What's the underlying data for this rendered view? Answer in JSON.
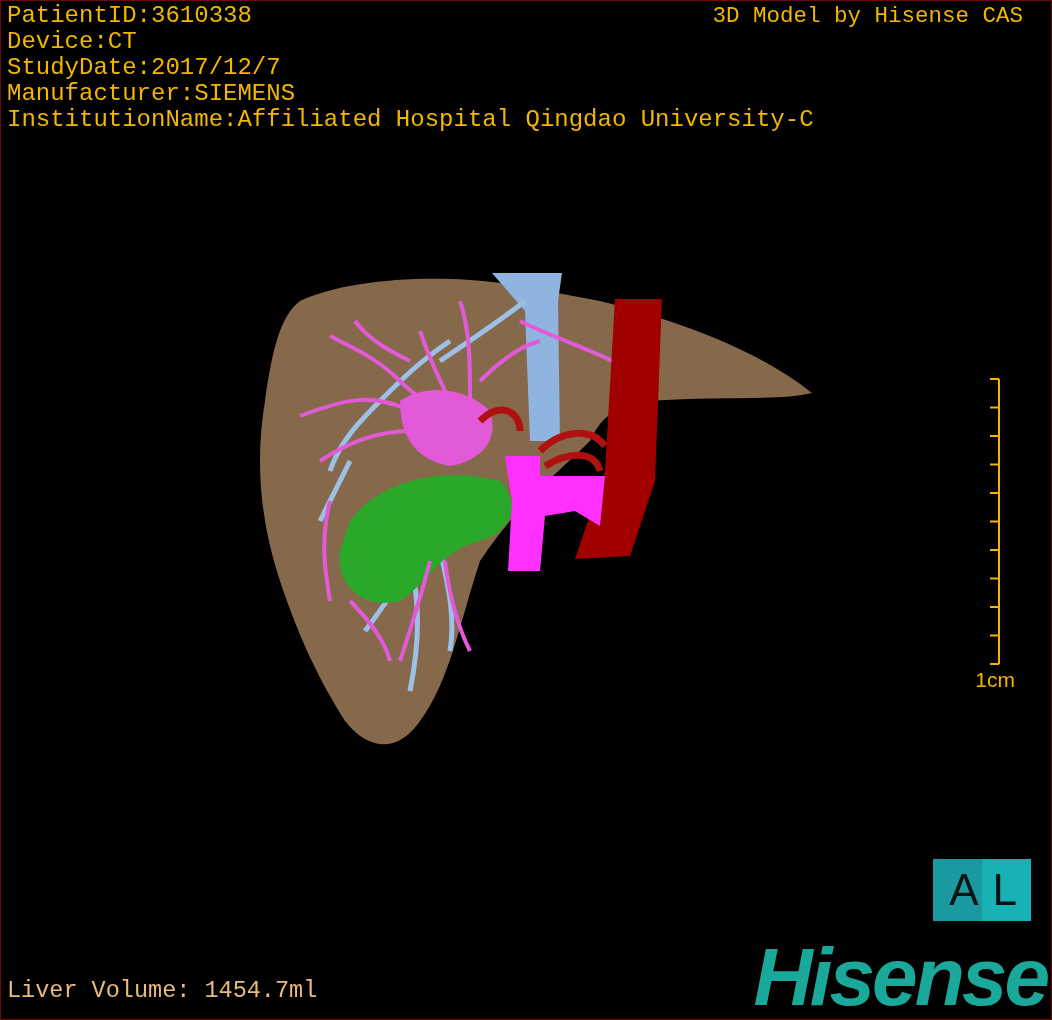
{
  "patient_info": [
    "PatientID:3610338",
    "Device:CT",
    "StudyDate:2017/12/7",
    "Manufacturer:SIEMENS",
    "InstitutionName:Affiliated Hospital Qingdao University-C"
  ],
  "title": "3D Model by Hisense CAS",
  "scale_bar": {
    "label": "1cm"
  },
  "orientation_marker": "AL",
  "liver_volume": "Liver Volume: 1454.7ml",
  "logo": "Hisense"
}
